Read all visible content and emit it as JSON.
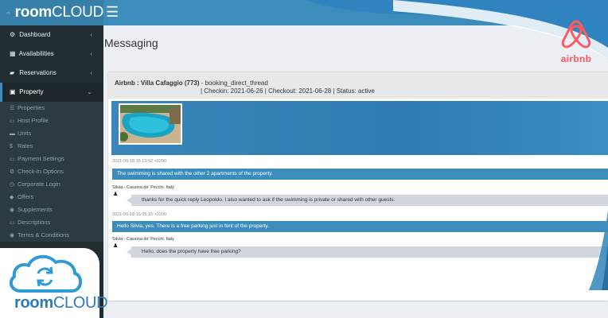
{
  "brand": {
    "bold": "room",
    "thin": "CLOUD"
  },
  "topbar": {
    "menu_icon": "☰"
  },
  "sidebar": {
    "items": [
      {
        "icon": "⚙",
        "label": "Dashboard",
        "chevron": "‹"
      },
      {
        "icon": "▦",
        "label": "Availabilities",
        "chevron": "‹"
      },
      {
        "icon": "▰",
        "label": "Reservations",
        "chevron": "‹"
      },
      {
        "icon": "▣",
        "label": "Property",
        "chevron": "⌄"
      }
    ],
    "sub_items": [
      {
        "icon": "☰",
        "label": "Properties"
      },
      {
        "icon": "▭",
        "label": "Host Profile"
      },
      {
        "icon": "▬",
        "label": "Units"
      },
      {
        "icon": "$",
        "label": "Rates"
      },
      {
        "icon": "▭",
        "label": "Payment Settings"
      },
      {
        "icon": "⚙",
        "label": "Check-In Options"
      },
      {
        "icon": "◷",
        "label": "Corporate Login"
      },
      {
        "icon": "◆",
        "label": "Offers"
      },
      {
        "icon": "◉",
        "label": "Supplements"
      },
      {
        "icon": "▭",
        "label": "Descriptions"
      },
      {
        "icon": "◉",
        "label": "Terms & Conditions"
      }
    ]
  },
  "page": {
    "title": "Messaging"
  },
  "thread": {
    "property": "Airbnb : Villa Cafaggio (773)",
    "thread_type": " - booking_direct_thread",
    "details": "| Checkin: 2021-06-26 | Checkout: 2021-06-28 | Status: active"
  },
  "messages": {
    "ts1": "2021-06-18 15:13:52 +0200",
    "out1": "The swimming is shared with the other 2 apartments of the property.",
    "sender1": "Silvia - Cassina de' Pecchi, Italy",
    "in1": "thanks for the quick reply Leopoldo. I also wanted to ask if the swimming is private or shared with other guests.",
    "ts2": "2021-06-18 15:05:15 +0200",
    "out2": "Hello Silvia, yes. There is a free parking just in font of the property.",
    "sender2": "Silvia - Cassina de' Pecchi, Italy",
    "in2": "Hello, does the property have free parking?"
  },
  "airbnb": {
    "wordmark": "airbnb"
  },
  "badge": {
    "bold": "room",
    "thin": "CLOUD"
  },
  "colors": {
    "primary": "#3c8dbc",
    "sidebar": "#222d32",
    "airbnb": "#ff5a5f"
  }
}
